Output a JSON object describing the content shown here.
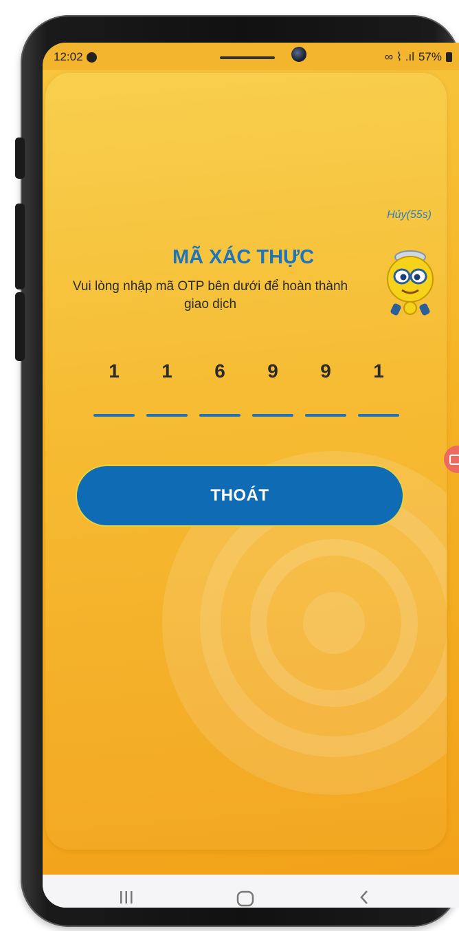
{
  "status_bar": {
    "time": "12:02",
    "signal_text": "∞ ⌇ .ıl",
    "battery_percent": "57%"
  },
  "otp_screen": {
    "cancel_label": "Hủy(55s)",
    "title": "MÃ XÁC THỰC",
    "description": "Vui lòng nhập mã OTP bên dưới để hoàn thành giao dịch",
    "otp_digits": [
      "1",
      "1",
      "6",
      "9",
      "9",
      "1"
    ],
    "exit_button_label": "THOÁT"
  },
  "colors": {
    "background": "#f5b324",
    "primary": "#0e6bb4",
    "title": "#1e74b8"
  },
  "icons": {
    "mascot": "robot-mascot-icon",
    "screen_record": "screen-record-icon",
    "nav_recents": "recents-icon",
    "nav_home": "home-icon",
    "nav_back": "back-icon"
  }
}
